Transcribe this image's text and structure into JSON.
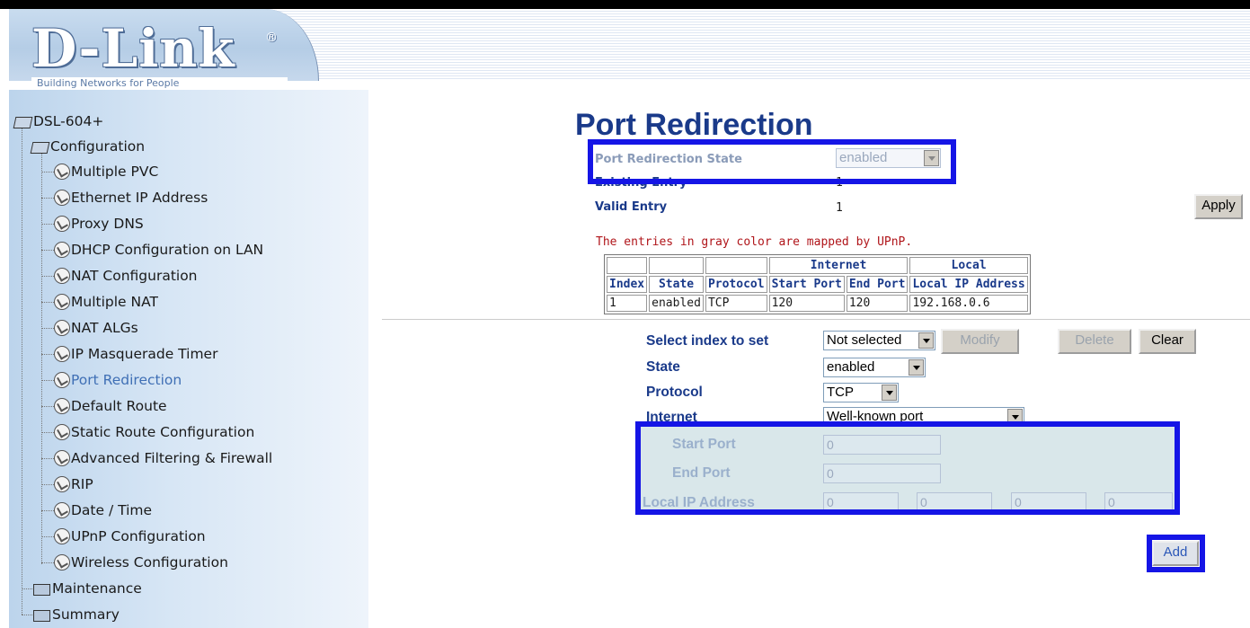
{
  "header": {
    "logo_text": "D-Link",
    "logo_reg": "®",
    "tagline": "Building Networks for People"
  },
  "sidebar": {
    "root": "DSL-604+",
    "config_folder": "Configuration",
    "items": [
      {
        "label": "Multiple PVC"
      },
      {
        "label": "Ethernet IP Address"
      },
      {
        "label": "Proxy DNS"
      },
      {
        "label": "DHCP Configuration on LAN"
      },
      {
        "label": "NAT Configuration"
      },
      {
        "label": "Multiple NAT"
      },
      {
        "label": "NAT ALGs"
      },
      {
        "label": "IP Masquerade Timer"
      },
      {
        "label": "Port Redirection"
      },
      {
        "label": "Default Route"
      },
      {
        "label": "Static Route Configuration"
      },
      {
        "label": "Advanced Filtering & Firewall"
      },
      {
        "label": "RIP"
      },
      {
        "label": "Date / Time"
      },
      {
        "label": "UPnP Configuration"
      },
      {
        "label": "Wireless Configuration"
      }
    ],
    "maintenance": "Maintenance",
    "summary": "Summary"
  },
  "main": {
    "title": "Port Redirection",
    "state_label": "Port Redirection State",
    "state_value": "enabled",
    "existing_label": "Existing Entry",
    "existing_value": "1",
    "valid_label": "Valid Entry",
    "valid_value": "1",
    "apply_label": "Apply",
    "note": "The entries in gray color are mapped by UPnP.",
    "table": {
      "group_internet": "Internet",
      "group_local": "Local",
      "headers": [
        "Index",
        "State",
        "Protocol",
        "Start Port",
        "End Port",
        "Local IP Address"
      ],
      "rows": [
        [
          "1",
          "enabled",
          "TCP",
          "120",
          "120",
          "192.168.0.6"
        ]
      ]
    },
    "form": {
      "select_index_label": "Select index to set",
      "select_index_value": "Not selected",
      "modify_label": "Modify",
      "delete_label": "Delete",
      "clear_label": "Clear",
      "state_label": "State",
      "state_value": "enabled",
      "protocol_label": "Protocol",
      "protocol_value": "TCP",
      "internet_label": "Internet",
      "internet_value": "Well-known port",
      "start_port_label": "Start Port",
      "start_port_value": "0",
      "end_port_label": "End Port",
      "end_port_value": "0",
      "local_ip_label": "Local IP Address",
      "ip_octets": [
        "0",
        "0",
        "0",
        "0"
      ],
      "add_label": "Add"
    }
  },
  "colors": {
    "highlight": "#1515e6",
    "title": "#1a3a8a",
    "note": "#b0151a"
  }
}
